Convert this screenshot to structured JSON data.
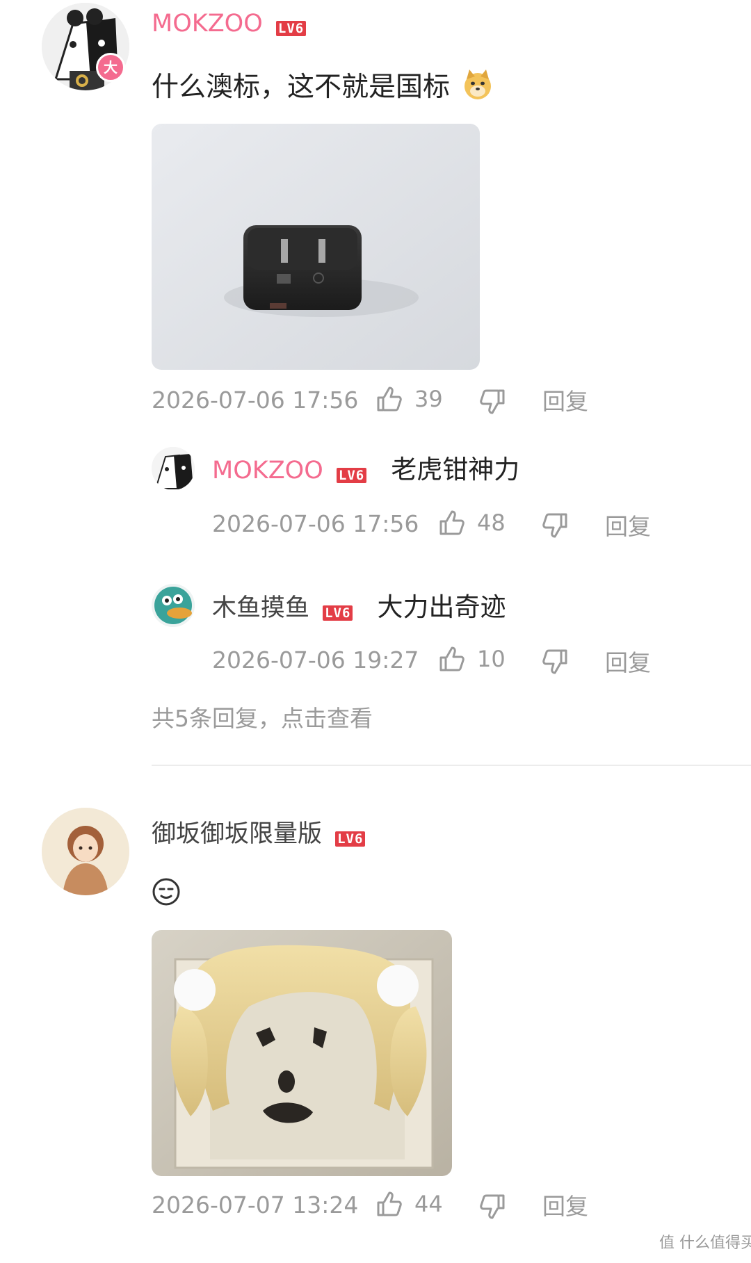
{
  "comments": [
    {
      "username": "MOKZOO",
      "level": "LV6",
      "avatar_badge": "大",
      "text": "什么澳标，这不就是国标",
      "emoji": "doge-emoji",
      "image": "black-charger-plug-photo",
      "date": "2026-07-06 17:56",
      "likes": "39",
      "reply_label": "回复",
      "replies": [
        {
          "username": "MOKZOO",
          "level": "LV6",
          "text": "老虎钳神力",
          "date": "2026-07-06 17:56",
          "likes": "48",
          "reply_label": "回复"
        },
        {
          "username": "木鱼摸鱼",
          "level": "LV6",
          "text": "大力出奇迹",
          "date": "2026-07-06 19:27",
          "likes": "10",
          "reply_label": "回复"
        }
      ],
      "more_replies": "共5条回复，点击查看"
    },
    {
      "username": "御坂御坂限量版",
      "level": "LV6",
      "text": "",
      "emoji": "sweat-smile-emoji",
      "image": "wall-socket-with-wig-photo",
      "date": "2026-07-07 13:24",
      "likes": "44",
      "reply_label": "回复"
    }
  ],
  "watermark": "值 什么值得买",
  "colors": {
    "username_pink": "#f46b8f",
    "level_badge": "#e33d46",
    "meta_gray": "#9a9a9a"
  }
}
